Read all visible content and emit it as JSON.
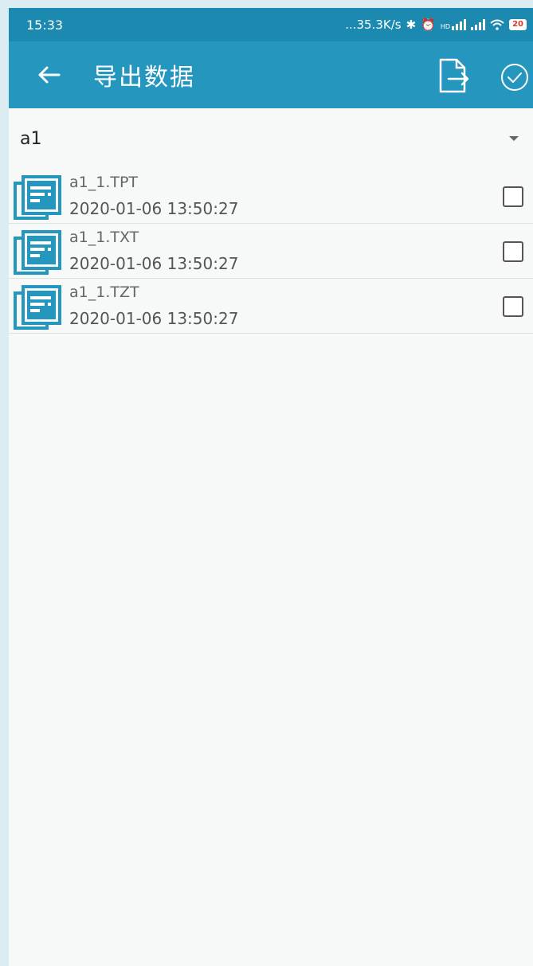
{
  "status_bar": {
    "time": "15:33",
    "network_speed": "...35.3K/s",
    "bluetooth_icon": "✱",
    "alarm_icon": "⏰",
    "hd_label": "HD",
    "battery": "20"
  },
  "app_bar": {
    "title": "导出数据",
    "back_icon": "arrow-left",
    "export_icon": "file-export",
    "confirm_icon": "check-circle"
  },
  "selector": {
    "value": "a1"
  },
  "files": [
    {
      "name": "a1_1.TPT",
      "time": "2020-01-06 13:50:27",
      "checked": false
    },
    {
      "name": "a1_1.TXT",
      "time": "2020-01-06 13:50:27",
      "checked": false
    },
    {
      "name": "a1_1.TZT",
      "time": "2020-01-06 13:50:27",
      "checked": false
    }
  ],
  "colors": {
    "app_bar": "#2596be",
    "status_bar": "#1c8ab0",
    "icon_blue": "#2596be",
    "background": "#f7f9f9"
  }
}
